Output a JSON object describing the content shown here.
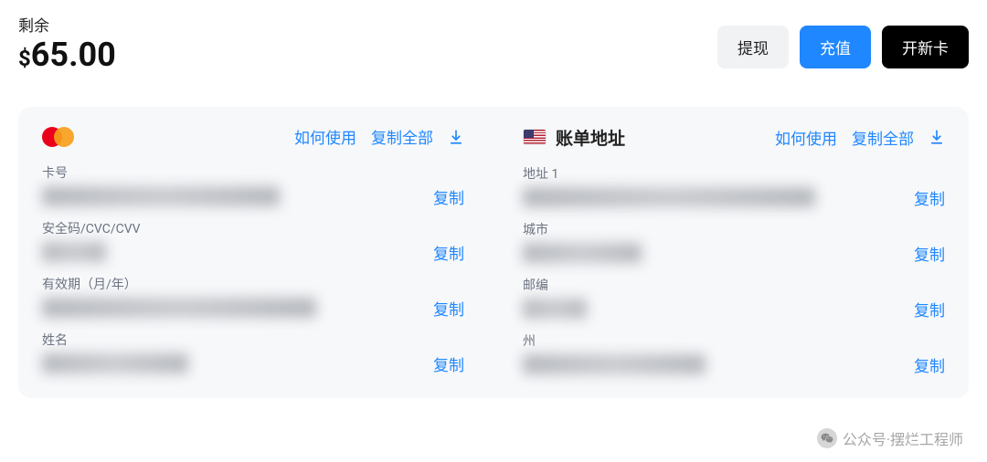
{
  "balance": {
    "label": "剩余",
    "currency": "$",
    "amount": "65.00"
  },
  "actions": {
    "withdraw": "提现",
    "recharge": "充值",
    "new_card": "开新卡"
  },
  "common": {
    "how_to_use": "如何使用",
    "copy_all": "复制全部",
    "copy": "复制"
  },
  "card_panel": {
    "fields": {
      "card_number": {
        "label": "卡号"
      },
      "cvv": {
        "label": "安全码/CVC/CVV"
      },
      "expiry": {
        "label": "有效期（月/年）"
      },
      "name": {
        "label": "姓名"
      }
    }
  },
  "billing_panel": {
    "title": "账单地址",
    "fields": {
      "address1": {
        "label": "地址 1"
      },
      "city": {
        "label": "城市"
      },
      "postal": {
        "label": "邮编"
      },
      "state": {
        "label": "州"
      }
    }
  },
  "watermark": {
    "text": "公众号·摆烂工程师"
  }
}
